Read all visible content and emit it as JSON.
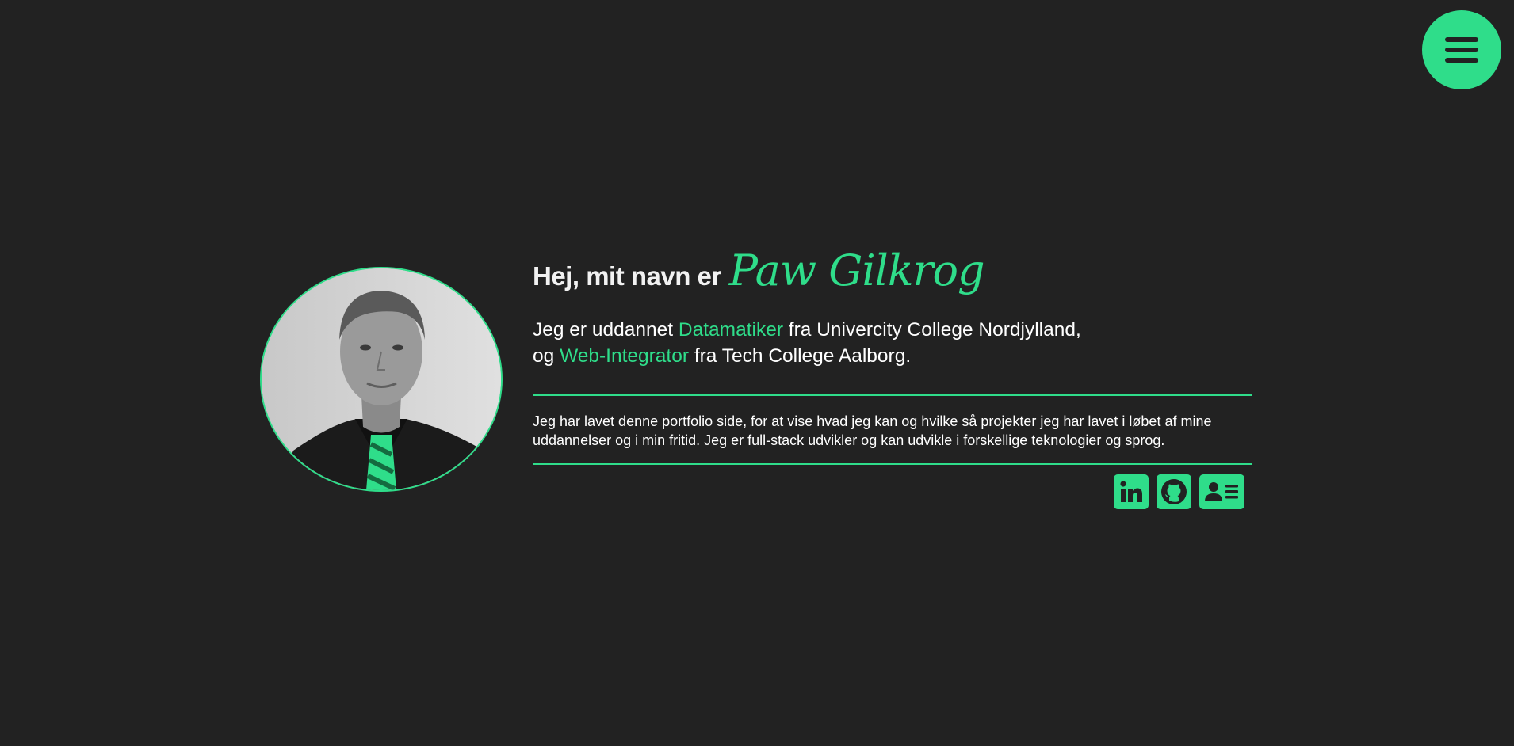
{
  "menu": {
    "icon": "hamburger-menu-icon"
  },
  "hero": {
    "greeting": "Hej, mit navn er",
    "name": "Paw Gilkrog",
    "intro": {
      "part1": "Jeg er uddannet ",
      "highlight1": "Datamatiker",
      "part2": " fra Univercity College Nordjylland,",
      "part3": "og ",
      "highlight2": "Web-Integrator",
      "part4": " fra Tech College Aalborg."
    },
    "about": "Jeg har lavet denne portfolio side, for at vise hvad jeg kan og hvilke så projekter jeg har lavet i løbet af mine uddannelser og i min fritid. Jeg er full-stack udvikler og kan udvikle i forskellige teknologier og sprog."
  },
  "socials": [
    {
      "icon": "linkedin-icon"
    },
    {
      "icon": "github-icon"
    },
    {
      "icon": "contact-card-icon"
    }
  ],
  "colors": {
    "background": "#222222",
    "accent": "#2fdd8a",
    "text": "#ffffff"
  }
}
